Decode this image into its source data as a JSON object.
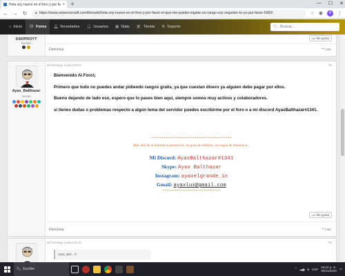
{
  "browser": {
    "tab_title": "Hola soy nuevo en el foro y por fa...",
    "tab_close": "×",
    "new_tab": "+",
    "url": "https://www.universocraft.com/threads/hola-soy-nuevo-en-el-foro-y-por-favor-el-que-me-pueda-regalar-un-rango-soy-seguidor-tu-yo-por-favor-5983/",
    "profile_initial": "A"
  },
  "nav": {
    "items": [
      {
        "label": "Inicio",
        "icon": "home-icon"
      },
      {
        "label": "Foros",
        "icon": "chat-icon",
        "active": true
      },
      {
        "label": "Novedades",
        "icon": "bell-icon"
      },
      {
        "label": "Usuarios",
        "icon": "user-icon"
      },
      {
        "label": "Stats",
        "icon": "stats-icon"
      },
      {
        "label": "Tienda",
        "icon": "cart-icon"
      },
      {
        "label": "Soporte",
        "icon": "lifebuoy-icon"
      }
    ],
    "search_placeholder": "Buscar..."
  },
  "post_prev": {
    "author": "DADPROYT",
    "author_title": "Novato",
    "like_label": "Me gusta",
    "report_label": "Denuncia",
    "reply_label": "Citar"
  },
  "post_main": {
    "time": "El Domingo a la(s) 04:21",
    "number": "#5",
    "author": "Ayax_Balthazar",
    "author_title": "Vicedo",
    "paragraphs": [
      "Bienvenido Al Foro!¡",
      "Primero que todo no puedes andar pidiendo rangos gratis, ya que cuestan dinero ya alguien debe pagar por ellos.",
      "Bueno dejando de lado eso, espero que lo pases bien aquí, siempre somos muy activos y colaboradores.",
      "si tienes dudas o problemas respecto a algún tema del servidor puedes escribirme por el foro o a mi discord AyaxBalthazar#1341."
    ],
    "signature": {
      "stars_top": "***************************************",
      "tagline": "Más allá de la humana experiencia, un gota de infierno, un toque de demencia...",
      "discord_label": "Mi Discord:",
      "discord_value": "AyaxBalthazar#1341",
      "skype_label": "Skype:",
      "skype_value": "Ayax Balthazar",
      "instagram_label": "Instagram:",
      "instagram_value": "ayaxelgrande_in",
      "gmail_label": "Gmail:",
      "gmail_value": "ayaxlux@gmail.com",
      "stars_bottom": "****************************"
    },
    "like_label": "Me gusta",
    "report_label": "Denuncia",
    "reply_label": "Citar"
  },
  "post_next": {
    "time": "El Domingo a la(s) 04:21",
    "number": "#6",
    "quote_author": "Ayax_Bal... ©"
  },
  "taskbar": {
    "search_text": "Escribe",
    "time": "09:02 p. m.",
    "date": "09/11/2020",
    "lang": "ESP"
  },
  "colors": {
    "accent_blue": "#2460a7",
    "signature_red": "#c0392b",
    "stars_orange": "#e8702a",
    "nav_gold": "#b89610"
  }
}
